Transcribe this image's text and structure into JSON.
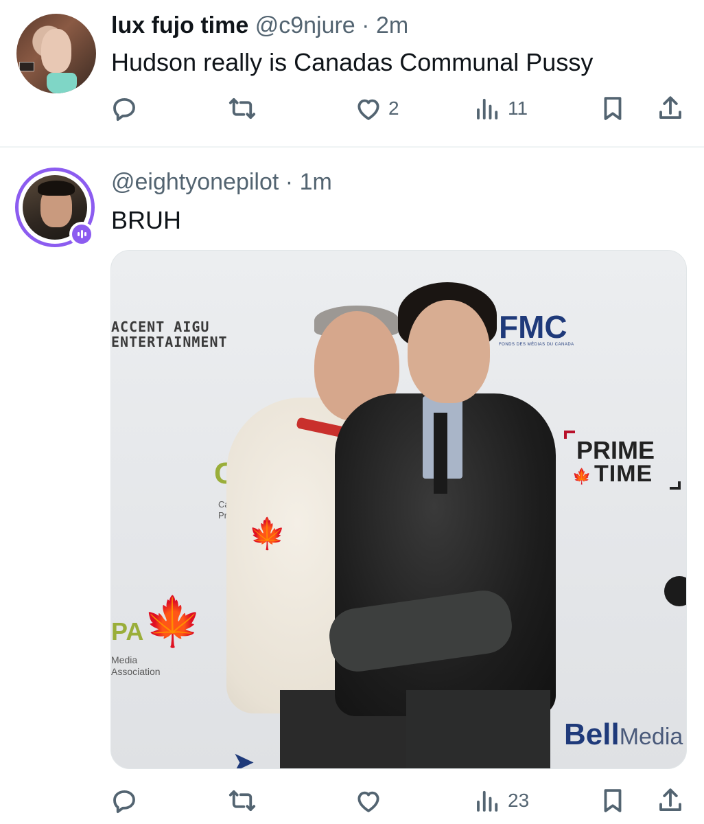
{
  "tweets": [
    {
      "display_name": "lux fujo time",
      "handle": "@c9njure",
      "separator": "·",
      "time": "2m",
      "text": "Hudson really is Canadas Communal Pussy",
      "actions": {
        "reply_count": "",
        "retweet_count": "",
        "like_count": "2",
        "views_count": "11"
      }
    },
    {
      "display_name": "",
      "handle": "@eightyonepilot",
      "separator": "·",
      "time": "1m",
      "text": "BRUH",
      "actions": {
        "reply_count": "",
        "retweet_count": "",
        "like_count": "",
        "views_count": "23"
      },
      "media": {
        "accent_line1": "ACCENT AIGU",
        "accent_line2": "ENTERTAINMENT",
        "fmc": "FMC",
        "fmc_sub": "FONDS DES MÉDIAS DU CANADA",
        "prime_line1": "PRIME",
        "prime_line2": "TIME",
        "cm": "CM",
        "cm_sub1": "Cana",
        "cm_sub2": "Pro",
        "pa": "PA",
        "pa_sub1": "Media",
        "pa_sub2": "Association",
        "bell": "Bell",
        "bell_media": "Media"
      }
    }
  ],
  "icons": [
    "reply-icon",
    "retweet-icon",
    "like-icon",
    "views-icon",
    "bookmark-icon",
    "share-icon",
    "maple-leaf-icon",
    "live-audio-icon"
  ],
  "colors": {
    "text": "#0f1419",
    "secondary": "#536471",
    "accent_ring": "#8c5cf0",
    "divider": "#eff3f4"
  }
}
